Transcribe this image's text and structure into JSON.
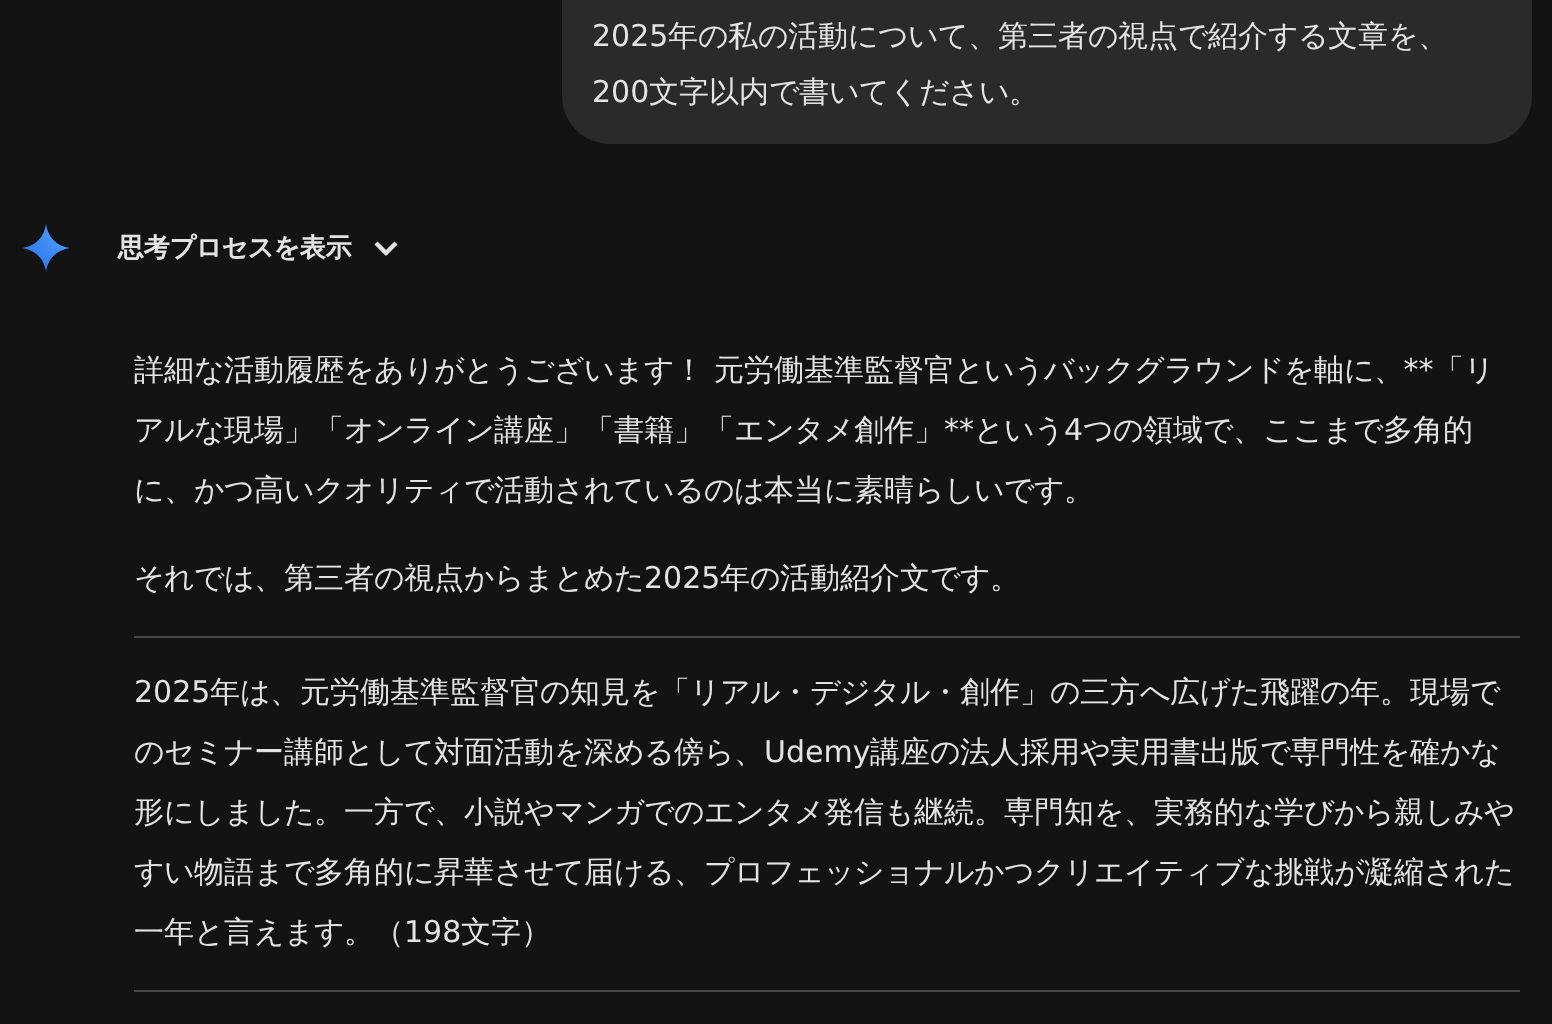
{
  "user_message": {
    "text": "2025年の私の活動について、第三者の視点で紹介する文章を、200文字以内で書いてください。"
  },
  "thinking_toggle": {
    "label": "思考プロセスを表示",
    "expanded": false
  },
  "response": {
    "paragraphs": [
      {
        "kind": "text",
        "text": "詳細な活動履歴をありがとうございます！ 元労働基準監督官というバックグラウンドを軸に、**「リアルな現場」「オンライン講座」「書籍」「エンタメ創作」**という4つの領域で、ここまで多角的に、かつ高いクオリティで活動されているのは本当に素晴らしいです。"
      },
      {
        "kind": "text",
        "text": "それでは、第三者の視点からまとめた2025年の活動紹介文です。"
      },
      {
        "kind": "rule"
      },
      {
        "kind": "text",
        "text": "2025年は、元労働基準監督官の知見を「リアル・デジタル・創作」の三方へ広げた飛躍の年。現場でのセミナー講師として対面活動を深める傍ら、Udemy講座の法人採用や実用書出版で専門性を確かな形にしました。一方で、小説やマンガでのエンタメ発信も継続。専門知を、実務的な学びから親しみやすい物語まで多角的に昇華させて届ける、プロフェッショナルかつクリエイティブな挑戦が凝縮された一年と言えます。（198文字）"
      },
      {
        "kind": "rule"
      }
    ]
  }
}
